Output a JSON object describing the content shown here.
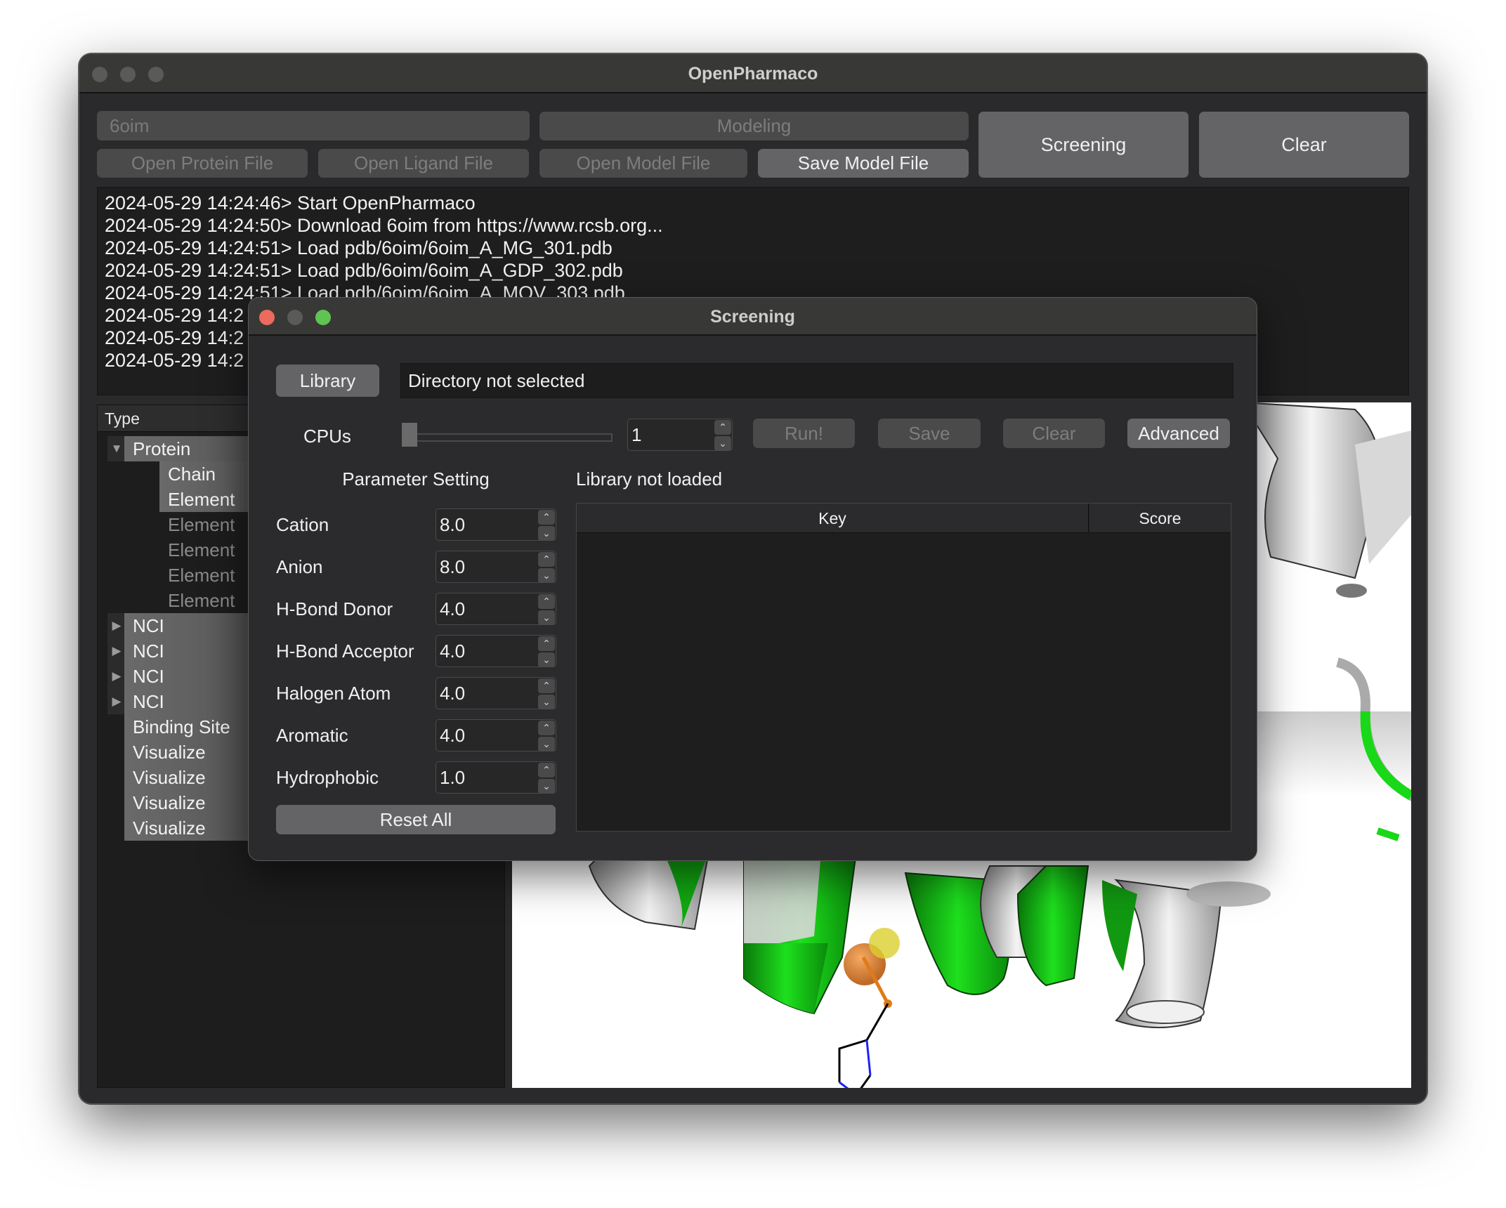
{
  "main_window": {
    "title": "OpenPharmaco",
    "pdb_id_field": {
      "value": "6oim"
    },
    "buttons": {
      "modeling": "Modeling",
      "open_protein_file": "Open Protein File",
      "open_ligand_file": "Open Ligand File",
      "open_model_file": "Open Model File",
      "save_model_file": "Save Model File",
      "screening": "Screening",
      "clear": "Clear"
    },
    "log_lines": [
      "2024-05-29 14:24:46> Start OpenPharmaco",
      "2024-05-29 14:24:50> Download 6oim from https://www.rcsb.org...",
      "2024-05-29 14:24:51> Load pdb/6oim/6oim_A_MG_301.pdb",
      "2024-05-29 14:24:51> Load pdb/6oim/6oim_A_GDP_302.pdb",
      "2024-05-29 14:24:51> Load pdb/6oim/6oim_A_MOV_303.pdb",
      "2024-05-29 14:2",
      "2024-05-29 14:2",
      "2024-05-29 14:2"
    ],
    "tree": {
      "header": "Type",
      "items": [
        {
          "label": "Protein",
          "expander": "expanded"
        },
        {
          "label": "Chain"
        },
        {
          "label": "Element"
        },
        {
          "label": "Element"
        },
        {
          "label": "Element"
        },
        {
          "label": "Element"
        },
        {
          "label": "Element"
        },
        {
          "label": "NCI",
          "expander": "collapsed"
        },
        {
          "label": "NCI",
          "expander": "collapsed"
        },
        {
          "label": "NCI",
          "expander": "collapsed"
        },
        {
          "label": "NCI",
          "expander": "collapsed"
        },
        {
          "label": "Binding Site"
        },
        {
          "label": "Visualize"
        },
        {
          "label": "Visualize"
        },
        {
          "label": "Visualize"
        },
        {
          "label": "Visualize"
        }
      ]
    },
    "viewer": {
      "colors": {
        "helix_highlight": "#00cc00",
        "helix_default": "#d0d0d0",
        "ligand_sphere": "#e07a1a",
        "nitrogen": "#2020ff"
      }
    }
  },
  "screening_dialog": {
    "title": "Screening",
    "library_button": "Library",
    "directory_field": "Directory not selected",
    "cpus_label": "CPUs",
    "cpus_slider_fraction": 0.0,
    "cpus_value": "1",
    "buttons": {
      "run": "Run!",
      "save": "Save",
      "clear": "Clear",
      "advanced": "Advanced",
      "reset_all": "Reset All"
    },
    "parameter_heading": "Parameter Setting",
    "parameters": [
      {
        "label": "Cation",
        "value": "8.0"
      },
      {
        "label": "Anion",
        "value": "8.0"
      },
      {
        "label": "H-Bond Donor",
        "value": "4.0"
      },
      {
        "label": "H-Bond Acceptor",
        "value": "4.0"
      },
      {
        "label": "Halogen Atom",
        "value": "4.0"
      },
      {
        "label": "Aromatic",
        "value": "4.0"
      },
      {
        "label": "Hydrophobic",
        "value": "1.0"
      }
    ],
    "library_status": "Library not loaded",
    "results_table": {
      "columns": [
        "Key",
        "Score"
      ],
      "rows": []
    }
  }
}
